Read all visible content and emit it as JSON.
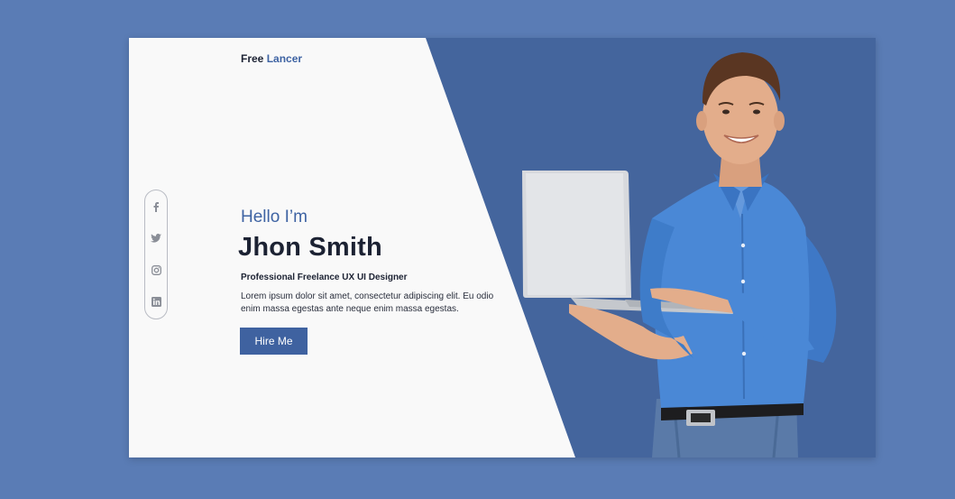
{
  "brand": {
    "first": "Free",
    "second": "Lancer"
  },
  "hero": {
    "greeting": "Hello  I’m",
    "name": "Jhon Smith",
    "role": "Professional Freelance UX UI Designer",
    "description": "Lorem ipsum dolor sit amet, consectetur adipiscing elit. Eu odio enim massa egestas ante neque enim massa egestas.",
    "cta_label": "Hire Me"
  },
  "social": [
    "facebook-icon",
    "twitter-icon",
    "instagram-icon",
    "linkedin-icon"
  ],
  "colors": {
    "page_bg": "#5a7cb5",
    "panel_blue": "#44659d",
    "accent": "#3e63a3",
    "card_bg": "#f9f9f9",
    "text_dark": "#1c2233"
  }
}
